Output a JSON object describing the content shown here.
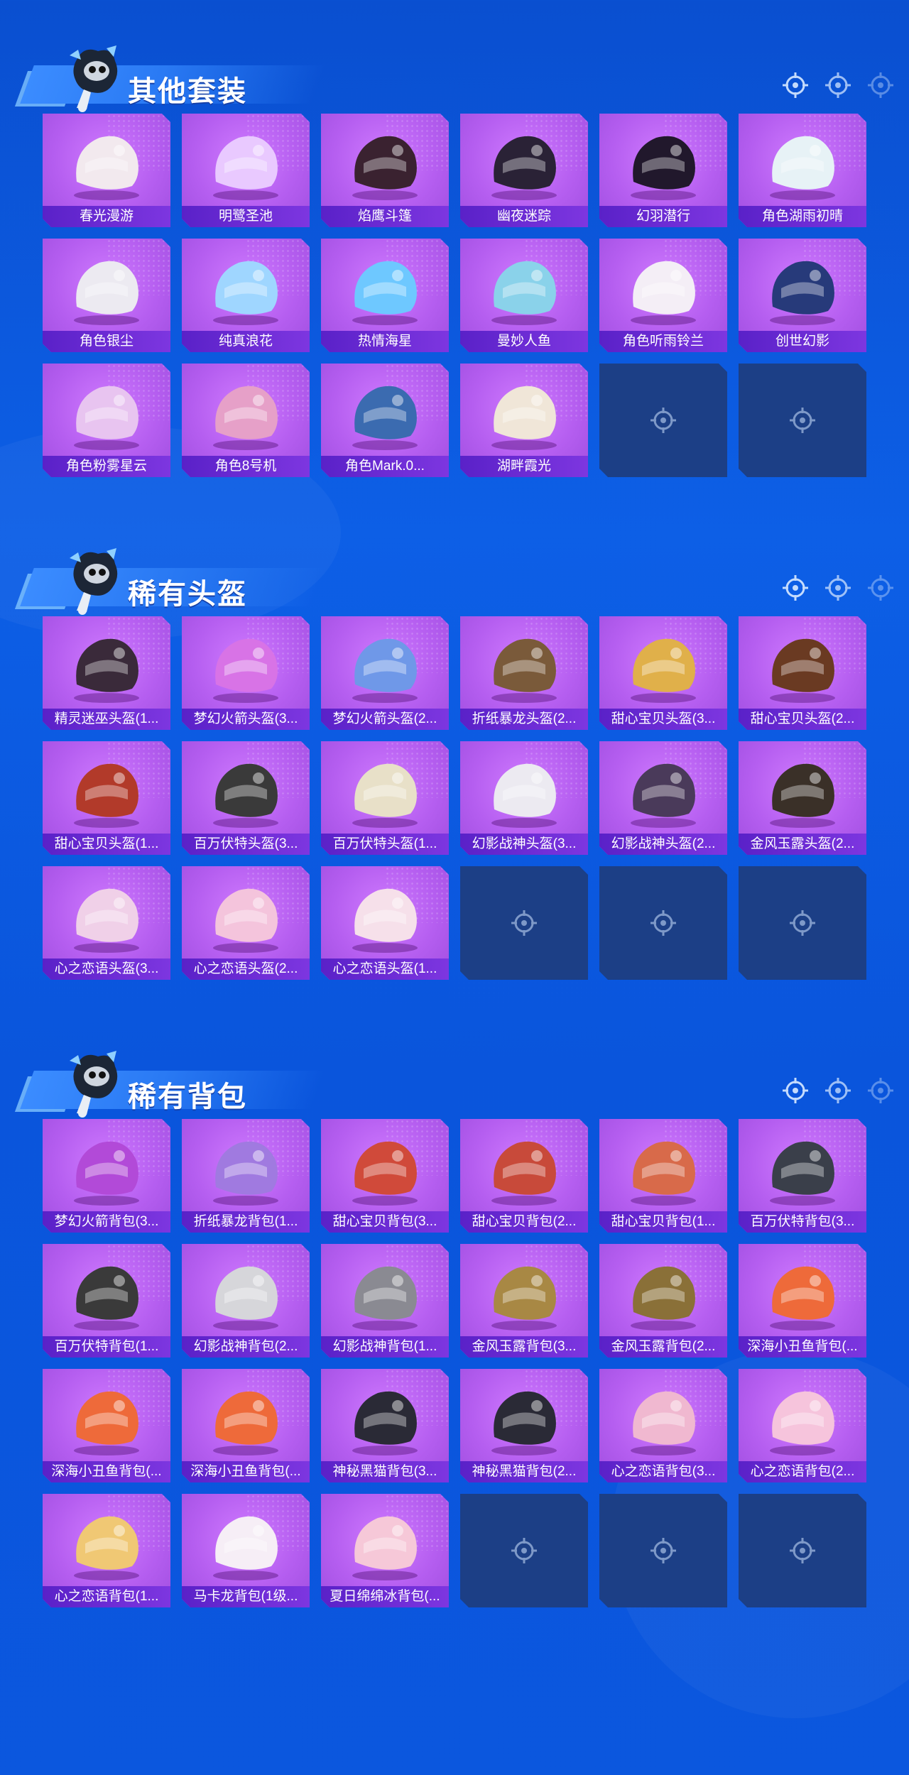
{
  "colors": {
    "background": "#0a55dc",
    "card": "#b55ef0",
    "label_bar": "#6a2ad4",
    "empty_card": "#1c3f86"
  },
  "sections": [
    {
      "title": "其他套装",
      "items": [
        "春光漫游",
        "明鹭圣池",
        "焰鹰斗篷",
        "幽夜迷踪",
        "幻羽潜行",
        "角色湖雨初晴",
        "角色银尘",
        "纯真浪花",
        "热情海星",
        "曼妙人鱼",
        "角色听雨铃兰",
        "创世幻影",
        "角色粉雾星云",
        "角色8号机",
        "角色Mark.0...",
        "湖畔霞光"
      ],
      "empty_slots": 2
    },
    {
      "title": "稀有头盔",
      "items": [
        "精灵迷巫头盔(1...",
        "梦幻火箭头盔(3...",
        "梦幻火箭头盔(2...",
        "折纸暴龙头盔(2...",
        "甜心宝贝头盔(3...",
        "甜心宝贝头盔(2...",
        "甜心宝贝头盔(1...",
        "百万伏特头盔(3...",
        "百万伏特头盔(1...",
        "幻影战神头盔(3...",
        "幻影战神头盔(2...",
        "金风玉露头盔(2...",
        "心之恋语头盔(3...",
        "心之恋语头盔(2...",
        "心之恋语头盔(1..."
      ],
      "empty_slots": 3
    },
    {
      "title": "稀有背包",
      "items": [
        "梦幻火箭背包(3...",
        "折纸暴龙背包(1...",
        "甜心宝贝背包(3...",
        "甜心宝贝背包(2...",
        "甜心宝贝背包(1...",
        "百万伏特背包(3...",
        "百万伏特背包(1...",
        "幻影战神背包(2...",
        "幻影战神背包(1...",
        "金风玉露背包(3...",
        "金风玉露背包(2...",
        "深海小丑鱼背包(...",
        "深海小丑鱼背包(...",
        "深海小丑鱼背包(...",
        "神秘黑猫背包(3...",
        "神秘黑猫背包(2...",
        "心之恋语背包(3...",
        "心之恋语背包(2...",
        "心之恋语背包(1...",
        "马卡龙背包(1级...",
        "夏日绵绵冰背包(..."
      ],
      "empty_slots": 3
    }
  ],
  "icons": {
    "section_mascot": "mascot-icon",
    "target": "crosshair-icon",
    "item_art": "item-thumbnail-icon"
  }
}
